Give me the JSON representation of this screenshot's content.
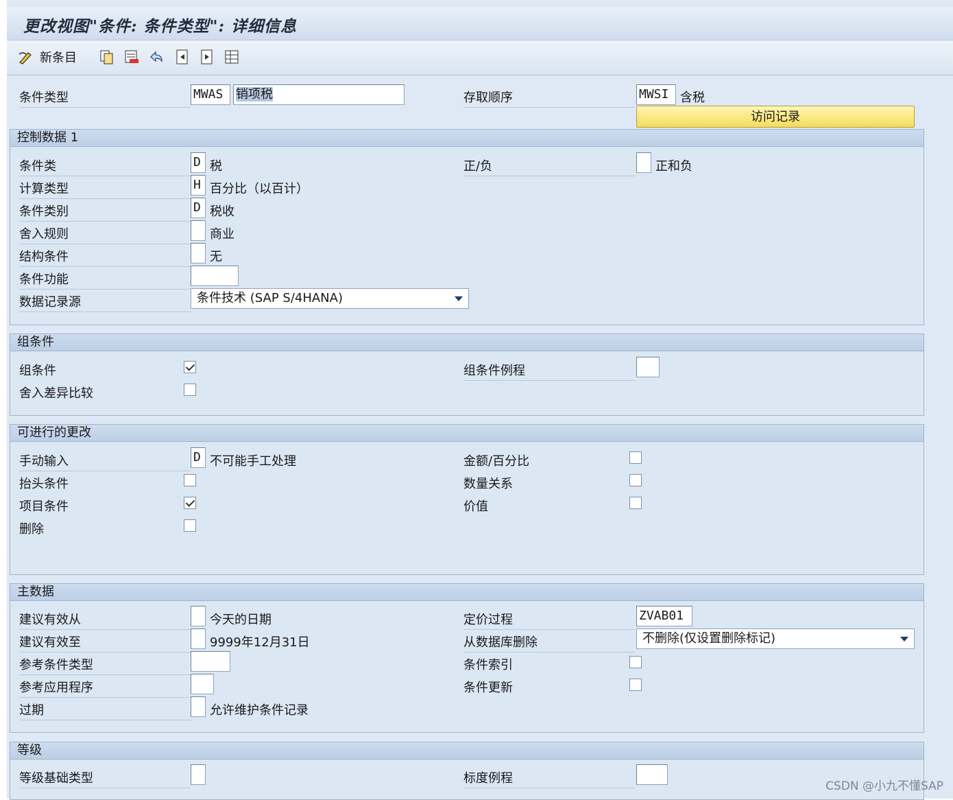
{
  "window": {
    "title": "更改视图\"条件: 条件类型\": 详细信息"
  },
  "toolbar": {
    "new_entries": "新条目"
  },
  "header": {
    "cond_type_label": "条件类型",
    "cond_type_code": "MWAS",
    "cond_type_name": "销项税",
    "access_seq_label": "存取顺序",
    "access_seq_code": "MWSI",
    "access_seq_name": "含税",
    "access_records_button": "访问记录"
  },
  "control1": {
    "title": "控制数据 1",
    "cond_class_label": "条件类",
    "cond_class_value": "D",
    "cond_class_desc": "税",
    "calc_type_label": "计算类型",
    "calc_type_value": "H",
    "calc_type_desc": "百分比（以百计）",
    "cond_category_label": "条件类别",
    "cond_category_value": "D",
    "cond_category_desc": "税收",
    "rounding_label": "舍入规则",
    "rounding_desc": "商业",
    "structure_label": "结构条件",
    "structure_desc": "无",
    "function_label": "条件功能",
    "source_label": "数据记录源",
    "source_value": "条件技术 (SAP S/4HANA)",
    "plus_minus_label": "正/负",
    "plus_minus_desc": "正和负"
  },
  "group": {
    "title": "组条件",
    "group_cond_label": "组条件",
    "group_cond_checked": true,
    "rounding_diff_label": "舍入差异比较",
    "rounding_diff_checked": false,
    "group_routine_label": "组条件例程"
  },
  "changes": {
    "title": "可进行的更改",
    "manual_label": "手动输入",
    "manual_value": "D",
    "manual_desc": "不可能手工处理",
    "header_label": "抬头条件",
    "header_checked": false,
    "item_label": "项目条件",
    "item_checked": true,
    "delete_label": "删除",
    "delete_checked": false,
    "amount_label": "金额/百分比",
    "amount_checked": false,
    "qty_label": "数量关系",
    "qty_checked": false,
    "value_label": "价值",
    "value_checked": false
  },
  "master": {
    "title": "主数据",
    "valid_from_label": "建议有效从",
    "valid_from_desc": "今天的日期",
    "valid_to_label": "建议有效至",
    "valid_to_desc": "9999年12月31日",
    "ref_type_label": "参考条件类型",
    "ref_app_label": "参考应用程序",
    "expired_label": "过期",
    "expired_desc": "允许维护条件记录",
    "pricing_proc_label": "定价过程",
    "pricing_proc_value": "ZVAB01",
    "delete_db_label": "从数据库删除",
    "delete_db_value": "不删除(仅设置删除标记)",
    "cond_index_label": "条件索引",
    "cond_index_checked": false,
    "cond_update_label": "条件更新",
    "cond_update_checked": false
  },
  "scales": {
    "title": "等级",
    "scale_base_label": "等级基础类型",
    "scale_routine_label": "标度例程"
  },
  "watermark": "CSDN @小九不懂SAP"
}
